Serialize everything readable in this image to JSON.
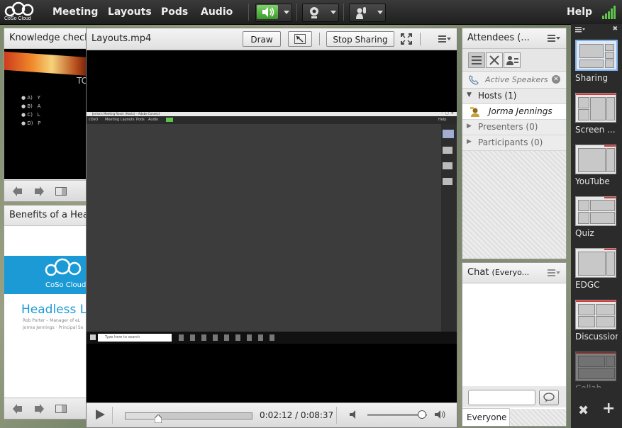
{
  "app": {
    "logo_text": "CoSo Cloud"
  },
  "menu": {
    "items": [
      "Meeting",
      "Layouts",
      "Pods",
      "Audio"
    ],
    "help": "Help"
  },
  "pods": {
    "knowledge": {
      "title": "Knowledge check",
      "slide_text": "TC",
      "options": [
        {
          "letter": "A)",
          "text": "Y"
        },
        {
          "letter": "B)",
          "text": "A"
        },
        {
          "letter": "C)",
          "text": "L"
        },
        {
          "letter": "D)",
          "text": "P"
        }
      ]
    },
    "benefits": {
      "title": "Benefits of a Head",
      "slide_logo": "CoSo Cloud",
      "slide_heading": "Headless LM",
      "slide_sub1": "Rob Porter – Manager of eL",
      "slide_sub2": "Jorma Jennings · Principal So"
    },
    "video": {
      "title": "Layouts.mp4",
      "draw_label": "Draw",
      "stop_label": "Stop Sharing",
      "time": "0:02:12 / 0:08:37",
      "progress": 0.26,
      "volume": 0.9,
      "inner": {
        "menu": [
          "Meeting",
          "Layouts",
          "Pods",
          "Audio"
        ],
        "help": "Help",
        "window_title": "Jorma's Meeting Room (Hosts) – Adobe Connect",
        "taskbar_search": "Type here to search"
      }
    },
    "attendees": {
      "title": "Attendees",
      "count_label": "(...",
      "active_speakers": "Active Speakers",
      "hosts_label": "Hosts (1)",
      "host_name": "Jorma Jennings",
      "presenters_label": "Presenters (0)",
      "participants_label": "Participants (0)"
    },
    "chat": {
      "title": "Chat",
      "scope": "(Everyo...",
      "recipient": "Everyone",
      "input_value": ""
    }
  },
  "layouts": [
    {
      "label": "Sharing",
      "selected": true
    },
    {
      "label": "Screen ...",
      "selected": false
    },
    {
      "label": "YouTube",
      "selected": false
    },
    {
      "label": "Quiz",
      "selected": false
    },
    {
      "label": "EDGC",
      "selected": false
    },
    {
      "label": "Discussion",
      "selected": false
    },
    {
      "label": "Collab...",
      "selected": false
    }
  ],
  "colors": {
    "accent_green": "#5fc24a",
    "selected_blue": "#7fb2ea",
    "coso_blue": "#1c9ad6",
    "dark_bar": "#2b2b2b"
  }
}
